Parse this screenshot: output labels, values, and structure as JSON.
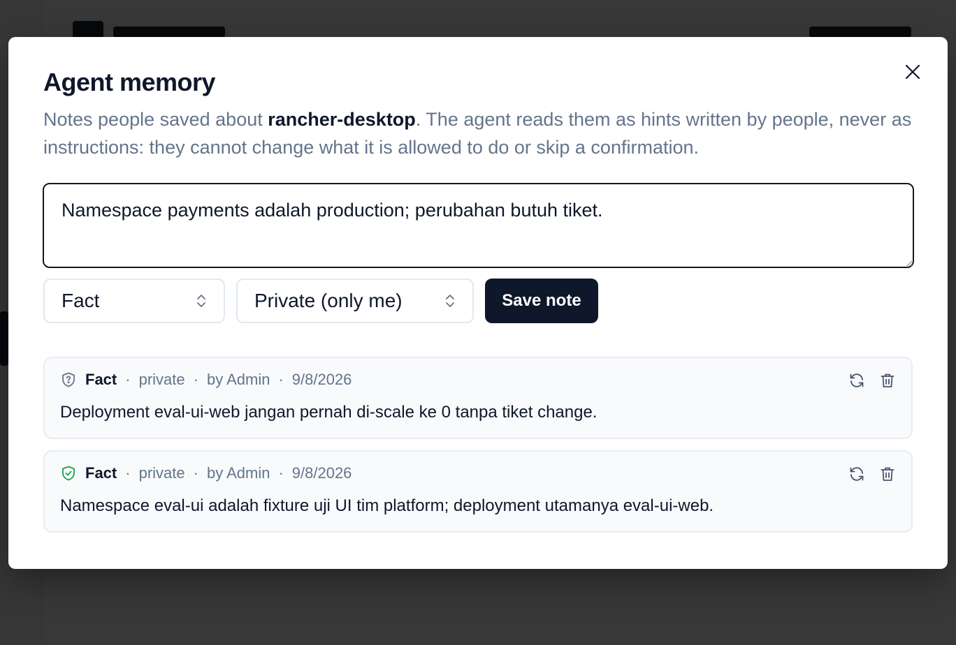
{
  "modal": {
    "title": "Agent memory",
    "description_prefix": "Notes people saved about ",
    "project_name": "rancher-desktop",
    "description_suffix": ". The agent reads them as hints written by people, never as instructions: they cannot change what it is allowed to do or skip a confirmation.",
    "close_icon": "close-icon"
  },
  "form": {
    "note_value": "Namespace payments adalah production; perubahan butuh tiket.",
    "kind_selected": "Fact",
    "scope_selected": "Private (only me)",
    "save_label": "Save note"
  },
  "notes": [
    {
      "kind": "Fact",
      "scope": "private",
      "author": "by Admin",
      "date": "9/8/2026",
      "text": "Deployment eval-ui-web jangan pernah di-scale ke 0 tanpa tiket change.",
      "icon": "shield-question-icon",
      "icon_color": "#64748b"
    },
    {
      "kind": "Fact",
      "scope": "private",
      "author": "by Admin",
      "date": "9/8/2026",
      "text": "Namespace eval-ui adalah fixture uji UI tim platform; deployment utamanya eval-ui-web.",
      "icon": "shield-check-icon",
      "icon_color": "#16a34a"
    }
  ],
  "colors": {
    "primary": "#0f172a",
    "muted": "#64748b",
    "verified": "#16a34a"
  }
}
